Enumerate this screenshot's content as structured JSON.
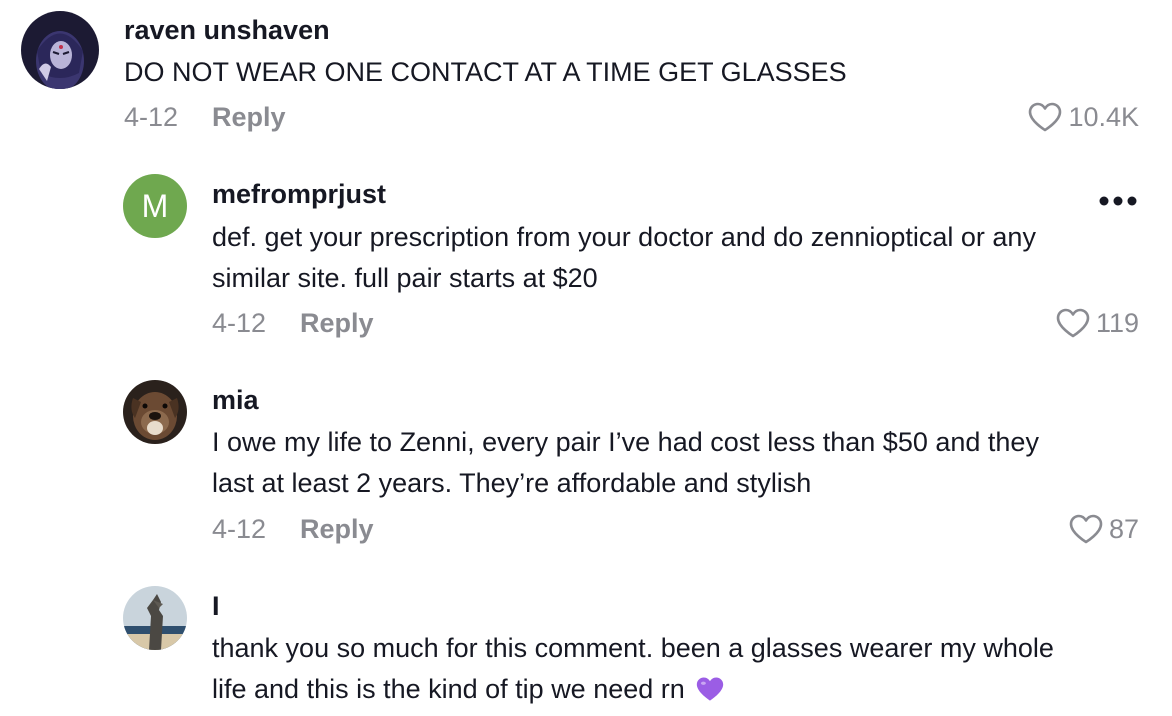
{
  "comments": [
    {
      "username": "raven unshaven",
      "text": "DO NOT WEAR ONE CONTACT AT A TIME GET GLASSES",
      "date": "4-12",
      "reply_label": "Reply",
      "likes": "10.4K",
      "avatar_icon": "character-avatar-icon"
    },
    {
      "username": "mefromprjust",
      "text_line1": "def. get your prescription from your doctor and do zennioptical or any",
      "text_line2": "similar site. full pair starts at $20",
      "date": "4-12",
      "reply_label": "Reply",
      "likes": "119",
      "avatar_letter": "M",
      "avatar_color": "#6fa84f",
      "more_label": "•••"
    },
    {
      "username": "mia",
      "text_line1": "I owe my life to Zenni, every pair I’ve had cost less than $50 and they",
      "text_line2": "last at least 2 years. They’re affordable and stylish",
      "date": "4-12",
      "reply_label": "Reply",
      "likes": "87",
      "avatar_icon": "dog-avatar-icon"
    },
    {
      "username": "I",
      "text_line1": "thank you so much for this comment. been a glasses wearer my whole",
      "text_line2": "life and this is the kind of tip we need rn",
      "emoji": "purple-heart-icon",
      "avatar_icon": "statue-avatar-icon"
    }
  ],
  "colors": {
    "text": "#161823",
    "muted": "#8a8b91",
    "accent_purple": "#9b5de5"
  }
}
